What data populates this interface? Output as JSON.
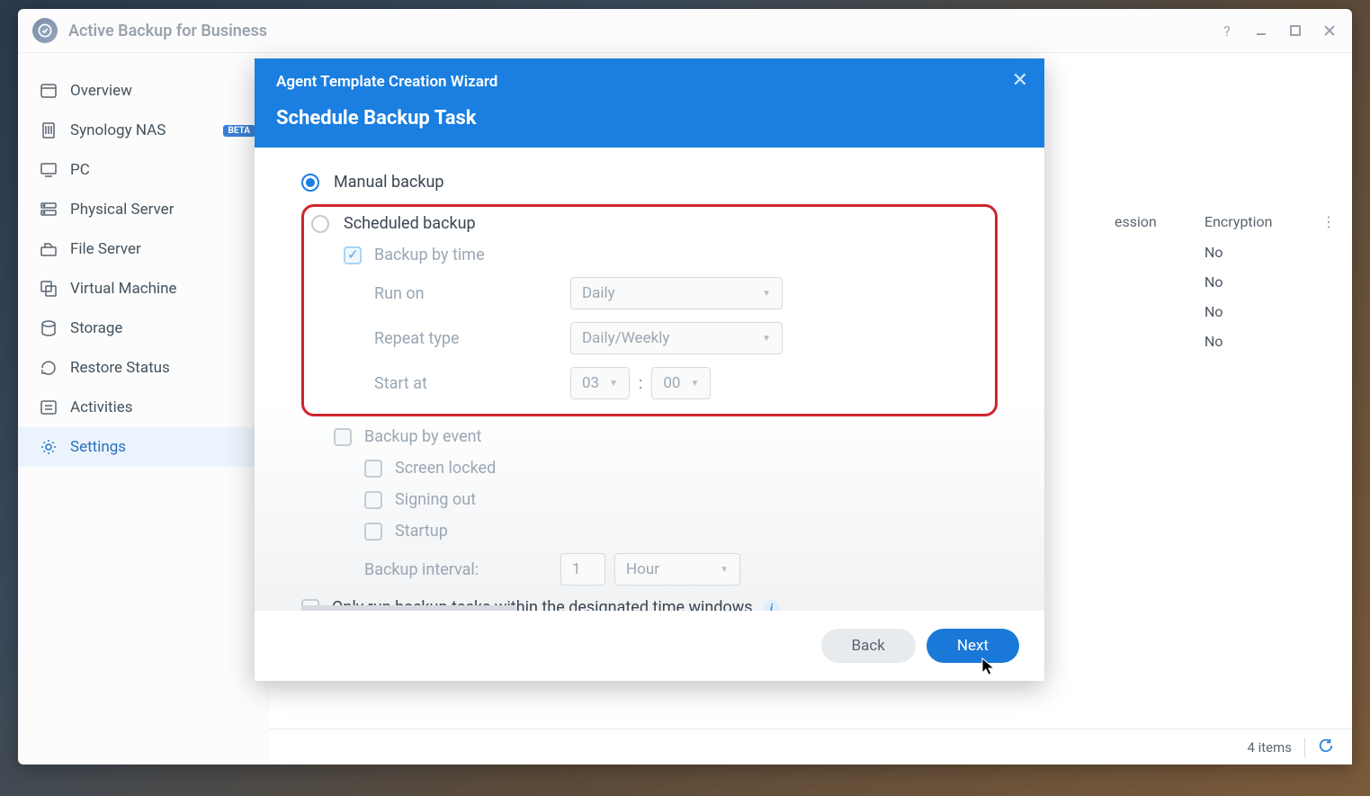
{
  "app": {
    "title": "Active Backup for Business"
  },
  "sidebar": {
    "items": [
      {
        "label": "Overview",
        "icon": "overview",
        "active": false
      },
      {
        "label": "Synology NAS",
        "icon": "nas",
        "active": false,
        "badge": "BETA"
      },
      {
        "label": "PC",
        "icon": "pc",
        "active": false
      },
      {
        "label": "Physical Server",
        "icon": "server",
        "active": false
      },
      {
        "label": "File Server",
        "icon": "file-server",
        "active": false
      },
      {
        "label": "Virtual Machine",
        "icon": "vm",
        "active": false
      },
      {
        "label": "Storage",
        "icon": "storage",
        "active": false
      },
      {
        "label": "Restore Status",
        "icon": "restore",
        "active": false
      },
      {
        "label": "Activities",
        "icon": "activities",
        "active": false
      },
      {
        "label": "Settings",
        "icon": "settings",
        "active": true
      }
    ]
  },
  "table": {
    "columns": {
      "session": "ession",
      "encryption": "Encryption"
    },
    "rows": [
      {
        "encryption": "No"
      },
      {
        "encryption": "No"
      },
      {
        "encryption": "No"
      },
      {
        "encryption": "No"
      }
    ]
  },
  "footer": {
    "count_label": "4 items"
  },
  "modal": {
    "wizard_title": "Agent Template Creation Wizard",
    "section_title": "Schedule Backup Task",
    "manual_backup_label": "Manual backup",
    "scheduled_backup_label": "Scheduled backup",
    "backup_by_time_label": "Backup by time",
    "run_on_label": "Run on",
    "run_on_value": "Daily",
    "repeat_type_label": "Repeat type",
    "repeat_type_value": "Daily/Weekly",
    "start_at_label": "Start at",
    "start_hour": "03",
    "start_minute": "00",
    "backup_by_event_label": "Backup by event",
    "screen_locked_label": "Screen locked",
    "signing_out_label": "Signing out",
    "startup_label": "Startup",
    "backup_interval_label": "Backup interval:",
    "backup_interval_value": "1",
    "backup_interval_unit": "Hour",
    "only_run_label": "Only run backup tasks within the designated time windows",
    "back_button": "Back",
    "next_button": "Next"
  }
}
